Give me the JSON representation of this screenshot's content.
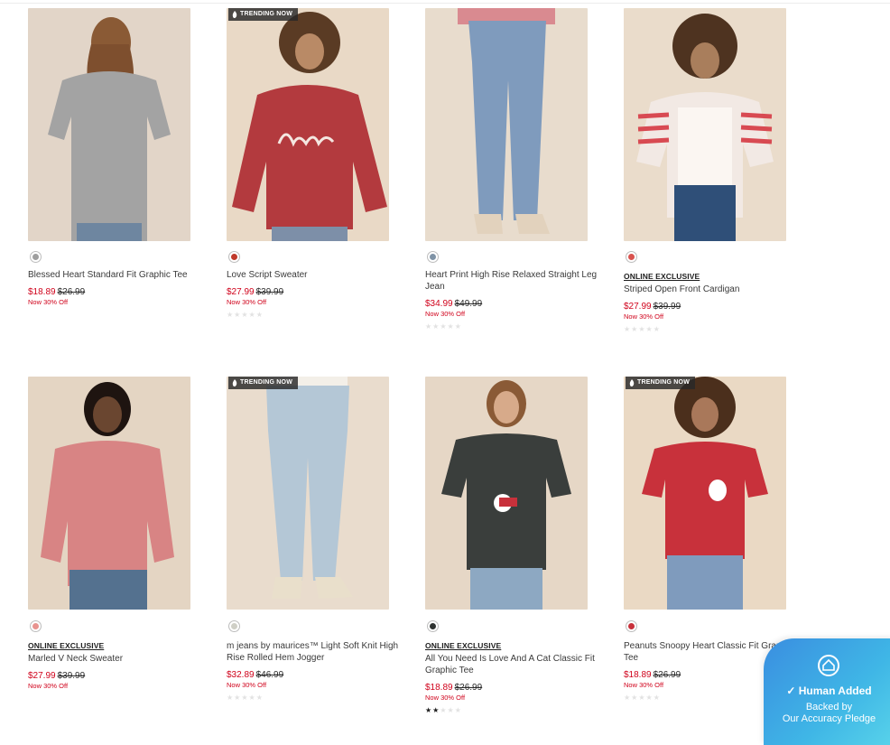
{
  "trending_label": "TRENDING NOW",
  "products": [
    {
      "name": "Blessed Heart Standard Fit Graphic Tee",
      "sale": "$18.89",
      "orig": "$26.99",
      "offer": "Now 30% Off",
      "exclusive": "",
      "swatch": "#9e9e9e",
      "trending": false,
      "rating": null
    },
    {
      "name": "Love Script Sweater",
      "sale": "$27.99",
      "orig": "$39.99",
      "offer": "Now 30% Off",
      "exclusive": "",
      "swatch": "#c0392b",
      "trending": true,
      "rating": 0
    },
    {
      "name": "Heart Print High Rise Relaxed Straight Leg Jean",
      "sale": "$34.99",
      "orig": "$49.99",
      "offer": "Now 30% Off",
      "exclusive": "",
      "swatch": "#7f93a6",
      "trending": false,
      "rating": 0
    },
    {
      "name": "Striped Open Front Cardigan",
      "sale": "$27.99",
      "orig": "$39.99",
      "offer": "Now 30% Off",
      "exclusive": "ONLINE EXCLUSIVE",
      "swatch": "#d9534f",
      "trending": false,
      "rating": 0
    },
    {
      "name": "Marled V Neck Sweater",
      "sale": "$27.99",
      "orig": "$39.99",
      "offer": "Now 30% Off",
      "exclusive": "ONLINE EXCLUSIVE",
      "swatch": "#e8938f",
      "trending": false,
      "rating": null
    },
    {
      "name": "m jeans by maurices™ Light Soft Knit High Rise Rolled Hem Jogger",
      "sale": "$32.89",
      "orig": "$46.99",
      "offer": "Now 30% Off",
      "exclusive": "",
      "swatch": "#cfcfc6",
      "trending": true,
      "rating": 0
    },
    {
      "name": "All You Need Is Love And A Cat Classic Fit Graphic Tee",
      "sale": "$18.89",
      "orig": "$26.99",
      "offer": "Now 30% Off",
      "exclusive": "ONLINE EXCLUSIVE",
      "swatch": "#2f3332",
      "trending": false,
      "rating": 2
    },
    {
      "name": "Peanuts Snoopy Heart Classic Fit Graphic Tee",
      "sale": "$18.89",
      "orig": "$26.99",
      "offer": "Now 30% Off",
      "exclusive": "",
      "swatch": "#c8313b",
      "trending": true,
      "rating": 0
    }
  ],
  "pledge": {
    "title": "Human Added",
    "line1": "Backed by",
    "line2": "Our Accuracy Pledge"
  }
}
